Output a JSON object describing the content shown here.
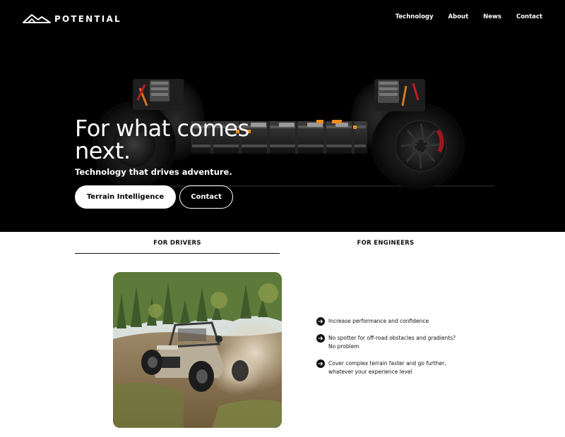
{
  "brand": {
    "name": "POTENTIAL",
    "icon": "mountain-logo-icon"
  },
  "nav": {
    "items": [
      "Technology",
      "About",
      "News",
      "Contact"
    ]
  },
  "hero": {
    "title": "For what comes next.",
    "subtitle": "Technology that drives adventure.",
    "primary_button": "Terrain Intelligence",
    "secondary_button": "Contact",
    "background_color": "#000000"
  },
  "tabs": {
    "drivers": "FOR DRIVERS",
    "engineers": "FOR ENGINEERS",
    "active": "FOR DRIVERS"
  },
  "features": {
    "items": [
      "Increase performance and confidence",
      "No spotter for off-road obstacles and gradients?\nNo problem",
      "Cover complex terrain faster and go further,\nwhatever your experience level"
    ],
    "icon": "arrow-right-circle-icon"
  },
  "colors": {
    "accent": "#f08a1c",
    "text": "#111111",
    "background": "#ffffff"
  }
}
